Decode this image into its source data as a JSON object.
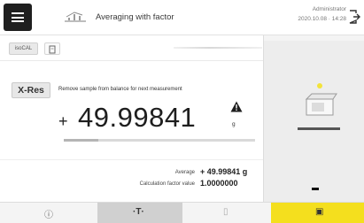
{
  "header": {
    "menu_icon": "hamburger-menu-icon",
    "method_icon": "averaging-method-icon",
    "title": "Averaging with factor",
    "user": "Administrator",
    "datetime": "2020.10.08 · 14:28",
    "logout_icon": "logout-icon"
  },
  "toolbar_top": {
    "isocal_label": "isoCAL",
    "doc_icon": "clipboard-icon"
  },
  "result": {
    "xres_label": "X-Res",
    "instruction": "Remove sample from balance for next measurement",
    "sign": "+",
    "weight": "49.99841",
    "unit": "g",
    "warning_icon": "warning-triangle-icon",
    "weighing_progress": 0.18
  },
  "stats": {
    "average_label": "Average",
    "average_value": "+ 49.99841 g",
    "factor_label": "Calculation factor value",
    "factor_value": "1.0000000"
  },
  "bottom_toolbar": [
    {
      "name": "info-button",
      "icon": "info-icon",
      "glyph": "ⓘ"
    },
    {
      "name": "tare-button",
      "icon": "tare-icon",
      "glyph": "·T·"
    },
    {
      "name": "zero-button",
      "icon": "zero-icon",
      "glyph": "▯"
    },
    {
      "name": "print-button",
      "icon": "print-result-icon",
      "glyph": "▣"
    }
  ],
  "colors": {
    "accent_yellow": "#f4df1e",
    "header_dark": "#1f1f1f",
    "panel_grey": "#ededed"
  }
}
